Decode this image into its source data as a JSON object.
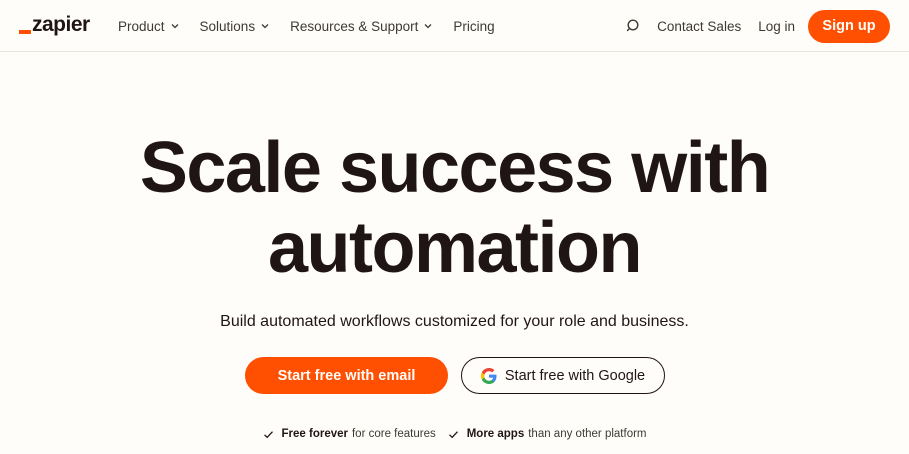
{
  "header": {
    "logo_text": "zapier",
    "nav": [
      {
        "label": "Product"
      },
      {
        "label": "Solutions"
      },
      {
        "label": "Resources & Support"
      },
      {
        "label": "Pricing"
      }
    ],
    "contact_sales": "Contact Sales",
    "login": "Log in",
    "signup": "Sign up"
  },
  "hero": {
    "title_line1": "Scale success with",
    "title_line2": "automation",
    "subtitle": "Build automated workflows customized for your role and business.",
    "cta_email": "Start free with email",
    "cta_google": "Start free with Google"
  },
  "features": [
    {
      "bold": "Free forever",
      "rest": "for core features"
    },
    {
      "bold": "More apps",
      "rest": "than any other platform"
    }
  ],
  "colors": {
    "brand": "#ff4f00",
    "background": "#fffdf9",
    "text": "#201515"
  },
  "icons": {
    "search": "search-icon",
    "chevron": "chevron-down-icon",
    "google": "google-icon",
    "check": "check-icon"
  }
}
